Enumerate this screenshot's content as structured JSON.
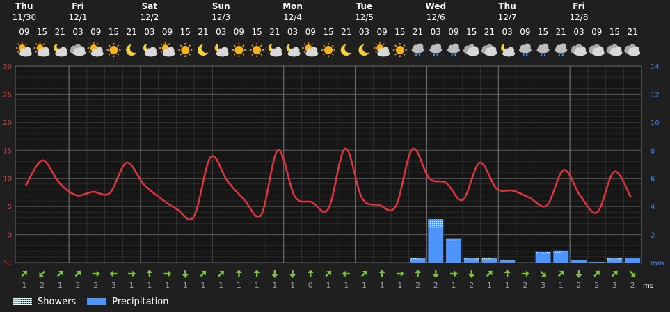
{
  "chart_data": {
    "type": "line",
    "days": [
      {
        "name": "Thu",
        "date": "11/30"
      },
      {
        "name": "Fri",
        "date": "12/1"
      },
      {
        "name": "Sat",
        "date": "12/2"
      },
      {
        "name": "Sun",
        "date": "12/3"
      },
      {
        "name": "Mon",
        "date": "12/4"
      },
      {
        "name": "Tue",
        "date": "12/5"
      },
      {
        "name": "Wed",
        "date": "12/6"
      },
      {
        "name": "Thu",
        "date": "12/7"
      },
      {
        "name": "Fri",
        "date": "12/8"
      }
    ],
    "hours": [
      "09",
      "15",
      "21",
      "03",
      "09",
      "15",
      "21",
      "03",
      "09",
      "15",
      "21",
      "03",
      "09",
      "15",
      "21",
      "03",
      "09",
      "15",
      "21",
      "03",
      "09",
      "15",
      "21",
      "03",
      "09",
      "15",
      "21",
      "03",
      "09",
      "15",
      "21",
      "03",
      "09",
      "15",
      "21"
    ],
    "icons": [
      "sun-cloud",
      "sun-cloud",
      "moon-cloud",
      "cloud",
      "sun-cloud",
      "sun",
      "moon",
      "moon-cloud",
      "sun-cloud",
      "sun",
      "moon",
      "moon-cloud",
      "sun",
      "sun",
      "moon-cloud",
      "moon-cloud",
      "sun-cloud",
      "sun",
      "moon",
      "moon",
      "sun-cloud",
      "sun",
      "rain",
      "rain",
      "rain",
      "cloud",
      "cloud",
      "moon-cloud",
      "rain",
      "rain",
      "rain",
      "cloud",
      "cloud",
      "cloud",
      "cloud"
    ],
    "temperature": [
      13.7,
      18.2,
      14.2,
      12.0,
      12.6,
      12.4,
      17.8,
      14.0,
      11.5,
      9.5,
      8.2,
      18.8,
      14.5,
      11.2,
      8.5,
      20.0,
      11.8,
      10.8,
      9.6,
      20.3,
      11.5,
      10.3,
      10.0,
      20.2,
      15.0,
      14.2,
      11.2,
      17.8,
      13.2,
      12.8,
      11.5,
      10.2,
      16.5,
      11.8,
      9.0,
      16.2,
      11.6
    ],
    "precipitation": [
      0,
      0,
      0,
      0,
      0,
      0,
      0,
      0,
      0,
      0,
      0,
      0,
      0,
      0,
      0,
      0,
      0,
      0,
      0,
      0,
      0,
      0,
      0.1,
      2.5,
      1.5,
      0.1,
      0.1,
      0.1,
      0,
      0.6,
      0.7,
      0.2,
      0.05,
      0.1,
      0.3
    ],
    "showers": [
      0,
      0,
      0,
      0,
      0,
      0,
      0,
      0,
      0,
      0,
      0,
      0,
      0,
      0,
      0,
      0,
      0,
      0,
      0,
      0,
      0,
      0,
      0.2,
      0.6,
      0.2,
      0.2,
      0.2,
      0.1,
      0,
      0.2,
      0.15,
      0,
      0,
      0.2,
      0
    ],
    "wind_dir": [
      "ne",
      "sw",
      "ne",
      "ne",
      "e",
      "w",
      "e",
      "n",
      "e",
      "s",
      "ne",
      "ne",
      "n",
      "n",
      "s",
      "s",
      "n",
      "ne",
      "w",
      "ne",
      "n",
      "e",
      "n",
      "s",
      "e",
      "s",
      "ne",
      "n",
      "e",
      "se",
      "ne",
      "s",
      "ne",
      "ne",
      "se"
    ],
    "wind_speed": [
      "1",
      "2",
      "1",
      "2",
      "2",
      "3",
      "1",
      "1",
      "1",
      "1",
      "1",
      "1",
      "1",
      "1",
      "1",
      "1",
      "0",
      "1",
      "1",
      "1",
      "1",
      "1",
      "2",
      "2",
      "1",
      "2",
      "1",
      "1",
      "2",
      "3",
      "1",
      "2",
      "2",
      "3",
      "2"
    ],
    "y_left": {
      "ticks": [
        "30",
        "25",
        "20",
        "15",
        "10",
        "5",
        "0",
        "°C"
      ]
    },
    "y_right": {
      "ticks": [
        "14",
        "12",
        "10",
        "8",
        "6",
        "4",
        "2",
        "mm"
      ]
    },
    "wind_unit": "ms",
    "legend": {
      "showers": "Showers",
      "precipitation": "Precipitation"
    },
    "colors": {
      "temperature": "#d9363e",
      "precip": "#4d94ff",
      "arrow": "#7bc142",
      "left_axis": "#d94040",
      "right_axis": "#2f8cff",
      "grid": "#4a4a4a",
      "wind_text": "#9a9a9a"
    }
  }
}
